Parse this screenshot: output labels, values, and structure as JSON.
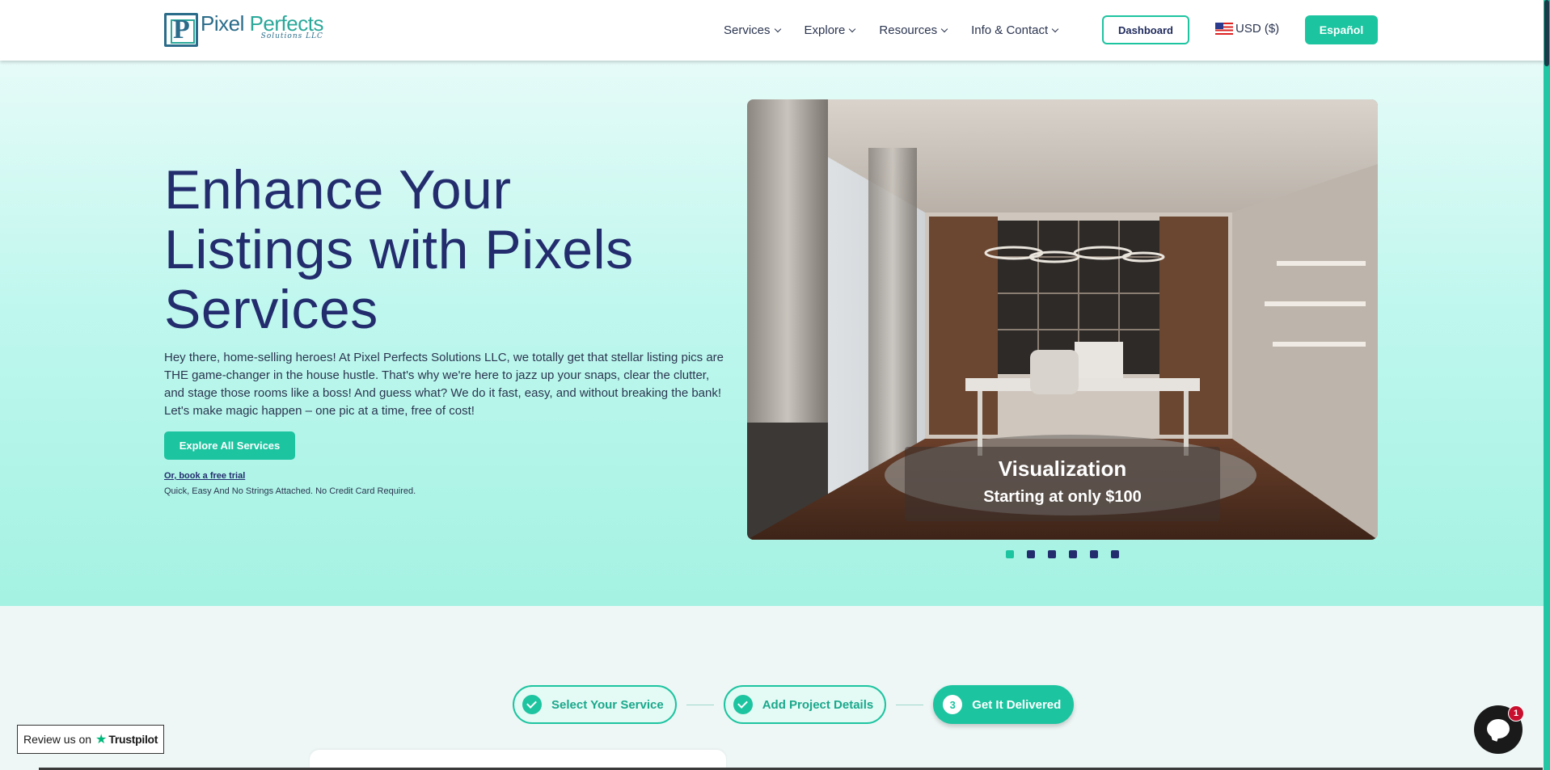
{
  "brand": {
    "name_part1": "Pixel ",
    "name_part2": "Perfects",
    "tagline": "Solutions LLC",
    "mark_letter": "P"
  },
  "nav": {
    "items": [
      {
        "label": "Services"
      },
      {
        "label": "Explore"
      },
      {
        "label": "Resources"
      },
      {
        "label": "Info & Contact"
      }
    ],
    "dashboard_label": "Dashboard",
    "currency_label": "USD ($)",
    "language_label": "Español"
  },
  "hero": {
    "title": "Enhance Your Listings with Pixels Services",
    "description": "Hey there, home-selling heroes! At Pixel Perfects Solutions LLC, we totally get that stellar listing pics are THE game-changer in the house hustle. That's why we're here to jazz up your snaps, clear the clutter, and stage those rooms like a boss! And guess what? We do it fast, easy, and without breaking the bank! Let's make magic happen – one pic at a time, free of cost!",
    "cta_label": "Explore All Services",
    "trial_link": "Or, book a free trial",
    "trial_note": "Quick, Easy And No Strings Attached. No Credit Card Required."
  },
  "slider": {
    "caption_title": "Visualization",
    "caption_subtitle": "Starting at only $100",
    "dot_count": 6,
    "active_index": 0
  },
  "steps": [
    {
      "label": "Select Your Service",
      "state": "done"
    },
    {
      "label": "Add Project Details",
      "state": "done"
    },
    {
      "label": "Get It Delivered",
      "state": "active",
      "number": "3"
    }
  ],
  "trustpilot": {
    "prefix": "Review us on",
    "brand": "Trustpilot"
  },
  "chat": {
    "badge_count": "1"
  },
  "colors": {
    "accent": "#1dc4a0",
    "heading": "#232d6e",
    "badge": "#c8102e"
  }
}
